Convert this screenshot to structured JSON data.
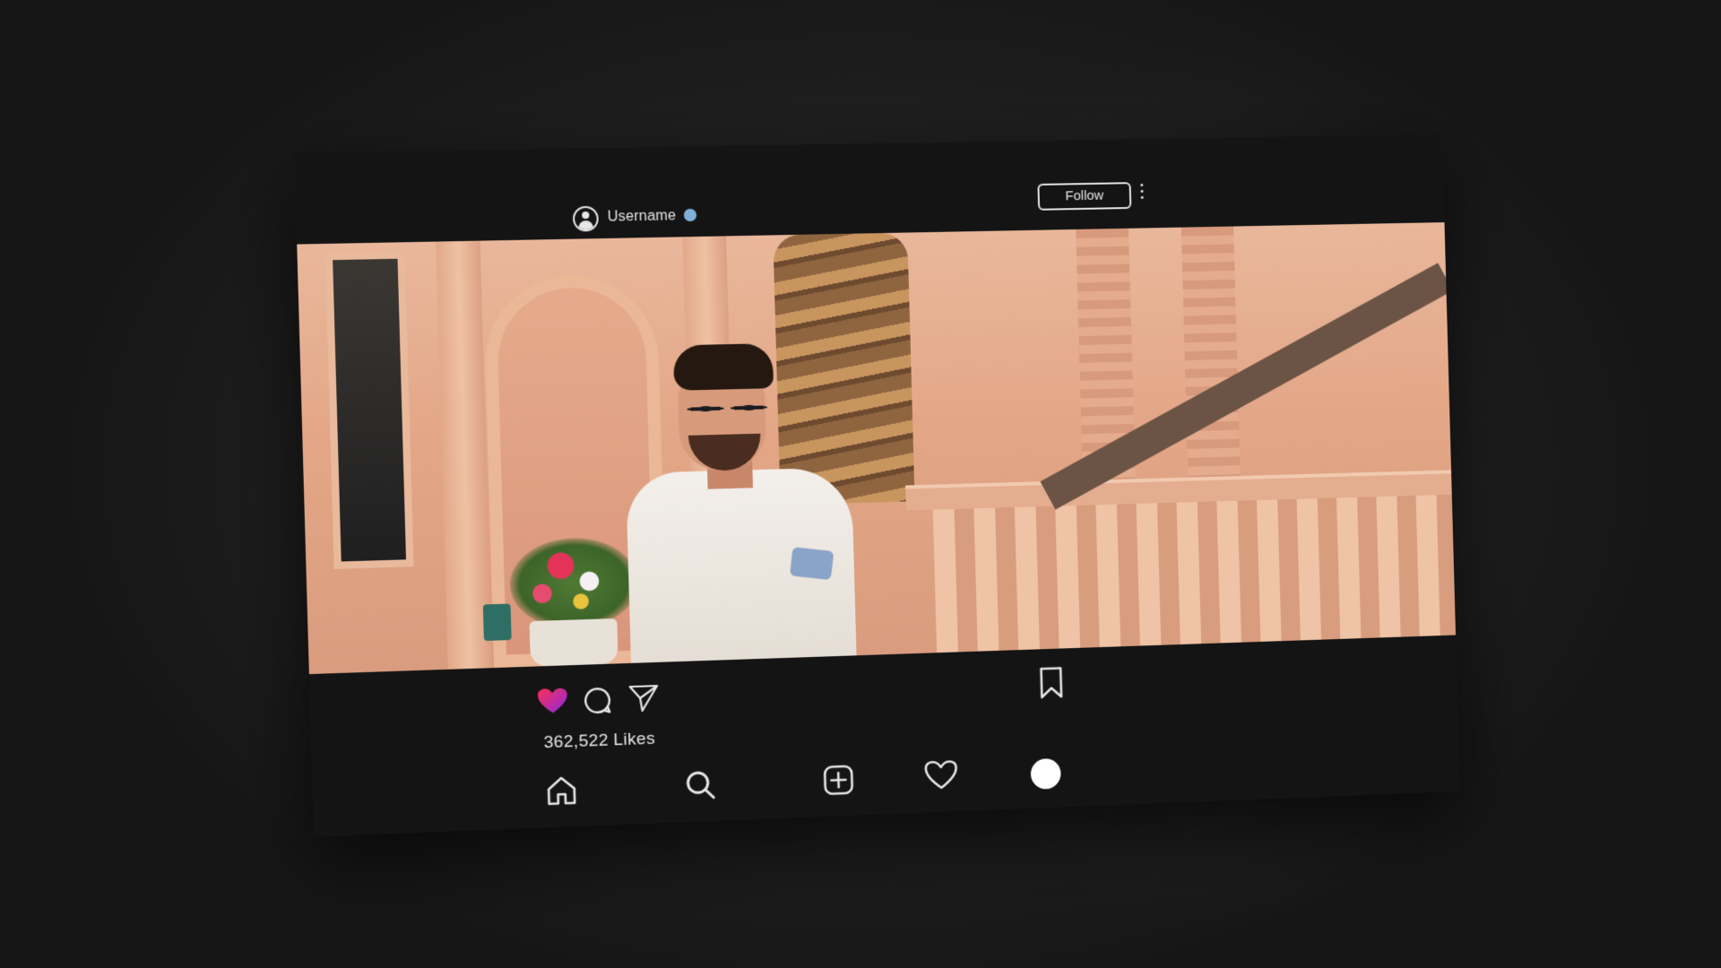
{
  "post": {
    "header": {
      "username": "Username",
      "verified": true,
      "follow_label": "Follow"
    },
    "likes_text": "362,522 Likes",
    "actions": {
      "like_icon": "heart-filled-icon",
      "comment_icon": "comment-icon",
      "share_icon": "send-icon",
      "save_icon": "bookmark-icon"
    }
  },
  "bottom_nav": {
    "items": [
      {
        "icon": "home-icon"
      },
      {
        "icon": "search-icon"
      },
      {
        "icon": "add-post-icon"
      },
      {
        "icon": "heart-outline-icon"
      },
      {
        "icon": "profile-avatar"
      }
    ]
  },
  "colors": {
    "background": "#1e1e1e",
    "card": "#141414",
    "text": "#e6e6e6",
    "like_gradient_start": "#ff2d55",
    "like_gradient_end": "#8a2be2",
    "verified_badge": "#7fb1d8"
  }
}
